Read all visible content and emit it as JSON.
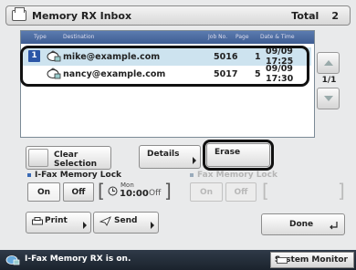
{
  "title": "Memory RX Inbox",
  "total_label": "Total",
  "total_value": "2",
  "columns": [
    "Type",
    "Destination",
    "Job No.",
    "Page",
    "Date & Time"
  ],
  "rows": [
    {
      "index": "1",
      "destination": "mike@example.com",
      "job_no": "5016",
      "pages": "1",
      "datetime": "09/09 17:25",
      "selected": true
    },
    {
      "index": "",
      "destination": "nancy@example.com",
      "job_no": "5017",
      "pages": "5",
      "datetime": "09/09 17:30",
      "selected": false
    }
  ],
  "page_indicator": "1/1",
  "buttons": {
    "clear_selection": "Clear\nSelection",
    "details": "Details",
    "erase": "Erase",
    "print": "Print",
    "send": "Send",
    "done": "Done"
  },
  "ifax_lock": {
    "label": "I-Fax Memory Lock",
    "on": "On",
    "off": "Off",
    "day": "Mon",
    "time": "10:00",
    "state": "Off"
  },
  "fax_lock": {
    "label": "Fax Memory Lock",
    "on": "On",
    "off": "Off"
  },
  "status": {
    "message": "I-Fax Memory RX is on.",
    "system_monitor": "System Monitor"
  },
  "colors": {
    "header": "#3e5d92",
    "selected_row": "#cde3ef",
    "status_bar": "#1b232d",
    "accent": "#2b56a7"
  }
}
